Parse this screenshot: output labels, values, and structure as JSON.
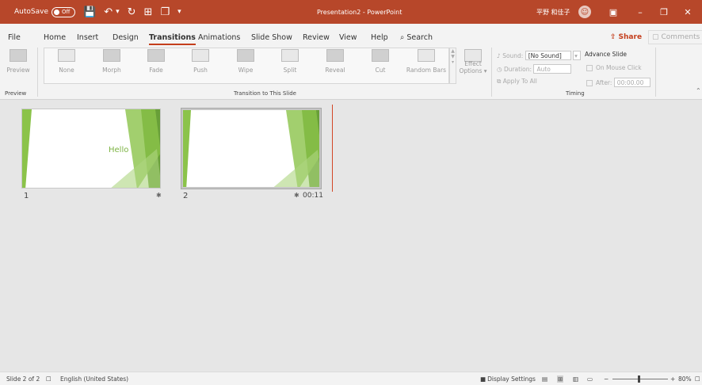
{
  "titlebar": {
    "autosave_label": "AutoSave",
    "autosave_state": "Off",
    "document_title": "Presentation2 - PowerPoint",
    "user_name": "平野 和佳子",
    "accent_color": "#b7472a"
  },
  "tabs": [
    "File",
    "Home",
    "Insert",
    "Design",
    "Transitions",
    "Animations",
    "Slide Show",
    "Review",
    "View",
    "Help"
  ],
  "active_tab": "Transitions",
  "search_label": "Search",
  "share_label": "Share",
  "comments_label": "Comments",
  "ribbon": {
    "preview_label": "Preview",
    "preview_group_label": "Preview",
    "transitions": [
      "None",
      "Morph",
      "Fade",
      "Push",
      "Wipe",
      "Split",
      "Reveal",
      "Cut",
      "Random Bars"
    ],
    "effect_options_line1": "Effect",
    "effect_options_line2": "Options",
    "transition_group_label": "Transition to This Slide",
    "sound_label": "Sound:",
    "sound_value": "[No Sound]",
    "duration_label": "Duration:",
    "duration_value": "Auto",
    "apply_to_all_label": "Apply To All",
    "advance_slide_label": "Advance Slide",
    "on_mouse_click_label": "On Mouse Click",
    "after_label": "After:",
    "after_value": "00:00.00",
    "timing_group_label": "Timing"
  },
  "slides": [
    {
      "number": "1",
      "title": "Hello",
      "time": ""
    },
    {
      "number": "2",
      "title": "",
      "time": "00:11"
    }
  ],
  "statusbar": {
    "slide_info": "Slide 2 of 2",
    "language": "English (United States)",
    "display_settings": "Display Settings",
    "zoom": "80%"
  }
}
